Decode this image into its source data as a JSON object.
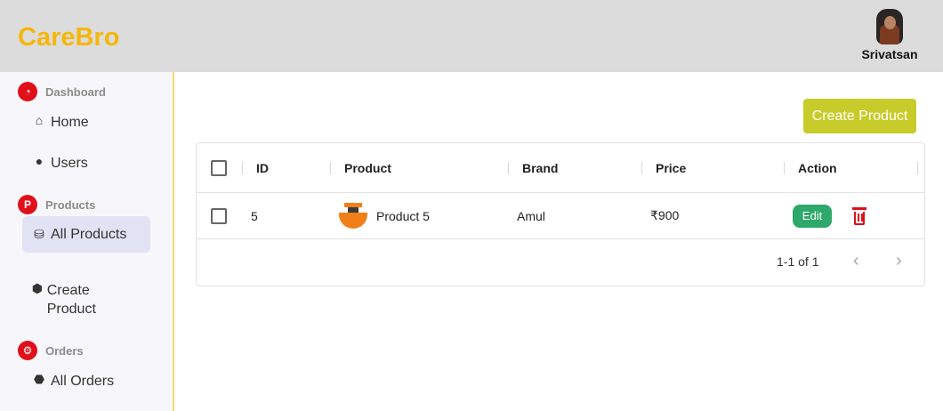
{
  "app": {
    "brand": "CareBro"
  },
  "user": {
    "name": "Srivatsan"
  },
  "sidebar": {
    "sections": [
      {
        "label": "Dashboard",
        "icon": "speedometer-icon",
        "items": [
          {
            "label": "Home",
            "icon": "home-icon"
          },
          {
            "label": "Users",
            "icon": "user-icon"
          }
        ]
      },
      {
        "label": "Products",
        "icon": "p-circle-icon",
        "items": [
          {
            "label": "All Products",
            "icon": "cubes-icon",
            "active": true
          },
          {
            "label": "Create Product",
            "icon": "box-icon"
          }
        ]
      },
      {
        "label": "Orders",
        "icon": "orders-icon",
        "items": [
          {
            "label": "All Orders",
            "icon": "hexagon-icon"
          }
        ]
      }
    ]
  },
  "main": {
    "create_button": "Create Product",
    "table": {
      "columns": [
        "ID",
        "Product",
        "Brand",
        "Price",
        "Action"
      ],
      "rows": [
        {
          "id": "5",
          "product": "Product 5",
          "brand": "Amul",
          "price": "₹900",
          "edit_label": "Edit"
        }
      ],
      "pagination": "1-1 of 1"
    }
  },
  "colors": {
    "brand": "#f5b70a",
    "accent_button": "#c7cc2b",
    "edit_button": "#2fa86b",
    "danger": "#e0101b"
  }
}
